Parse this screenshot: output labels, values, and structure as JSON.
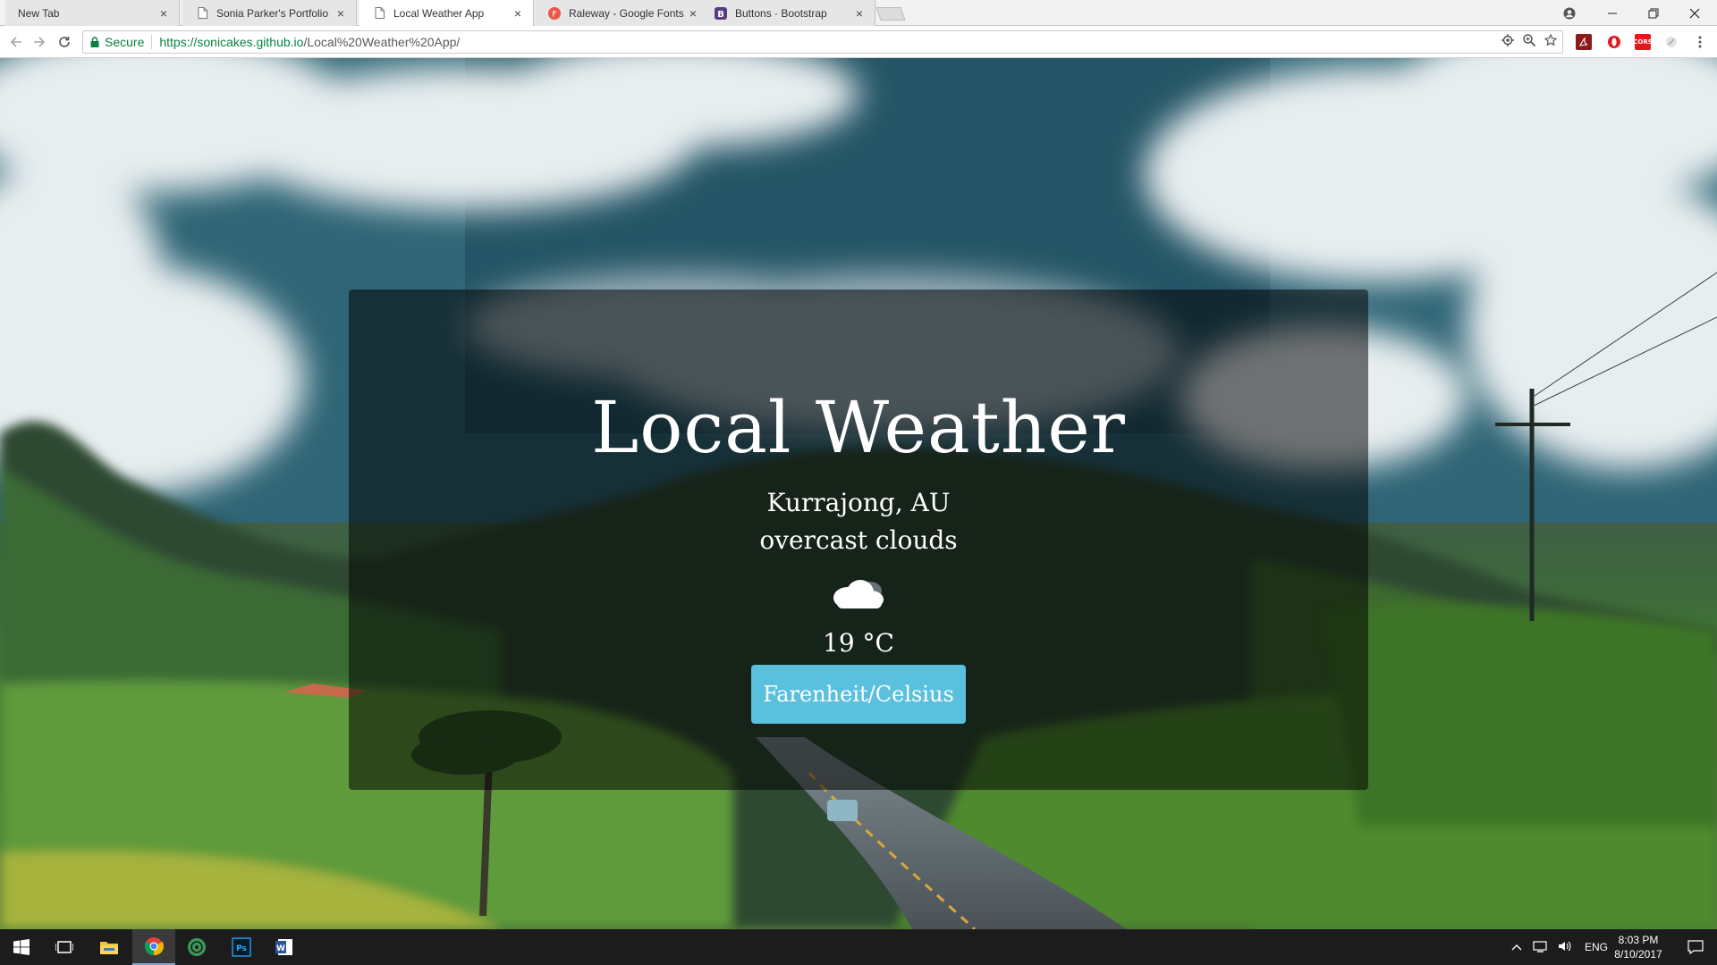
{
  "browser": {
    "tabs": [
      {
        "title": "New Tab",
        "icon": "none",
        "active": false
      },
      {
        "title": "Sonia Parker's Portfolio",
        "icon": "page-icon",
        "active": false
      },
      {
        "title": "Local Weather App",
        "icon": "page-icon",
        "active": true
      },
      {
        "title": "Raleway - Google Fonts",
        "icon": "google-fonts-icon",
        "active": false
      },
      {
        "title": "Buttons · Bootstrap",
        "icon": "bootstrap-icon",
        "active": false
      }
    ],
    "close_glyph": "×",
    "secure_label": "Secure",
    "url_host": "https://sonicakes.github.io",
    "url_path": "/Local%20Weather%20App/"
  },
  "app": {
    "title": "Local Weather",
    "location": "Kurrajong, AU",
    "description": "overcast clouds",
    "weather_icon": "cloud-icon",
    "temperature": "19 °C",
    "toggle_button_label": "Farenheit/Celsius",
    "button_color": "#5bc0de"
  },
  "taskbar": {
    "language": "ENG",
    "time": "8:03 PM",
    "date": "8/10/2017",
    "apps": [
      "start-icon",
      "task-view-icon",
      "file-explorer-icon",
      "chrome-icon",
      "spotify-icon",
      "photoshop-icon",
      "word-icon"
    ]
  }
}
